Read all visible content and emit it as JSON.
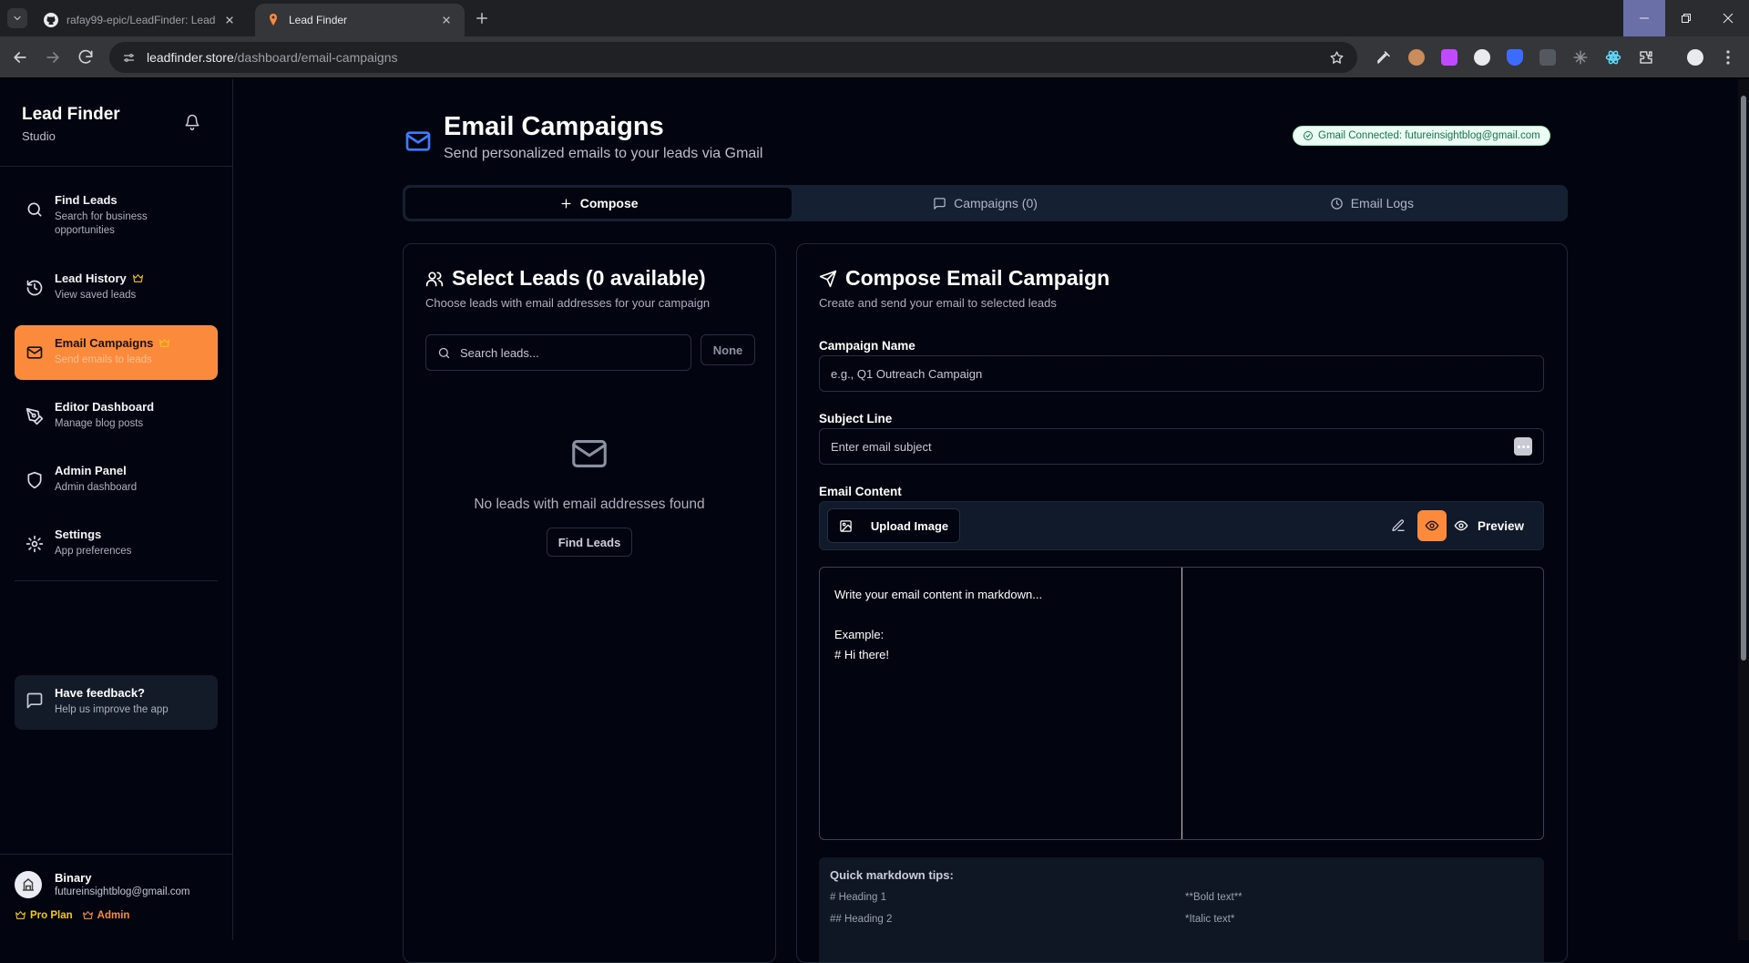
{
  "browser": {
    "tabs": [
      {
        "title": "rafay99-epic/LeadFinder: Lead",
        "icon": "github-icon"
      },
      {
        "title": "Lead Finder",
        "icon": "pin-icon"
      }
    ],
    "url_host": "leadfinder.store",
    "url_path": "/dashboard/email-campaigns"
  },
  "sidebar": {
    "brand_title": "Lead Finder",
    "brand_subtitle": "Studio",
    "items": [
      {
        "label": "Find Leads",
        "sub": "Search for business opportunities",
        "icon": "search-icon"
      },
      {
        "label": "Lead History",
        "sub": "View saved leads",
        "icon": "history-icon",
        "crown": true
      },
      {
        "label": "Email Campaigns",
        "sub": "Send emails to leads",
        "icon": "mail-icon",
        "crown": true,
        "active": true
      },
      {
        "label": "Editor Dashboard",
        "sub": "Manage blog posts",
        "icon": "pen-icon"
      },
      {
        "label": "Admin Panel",
        "sub": "Admin dashboard",
        "icon": "shield-icon"
      },
      {
        "label": "Settings",
        "sub": "App preferences",
        "icon": "gear-icon"
      }
    ],
    "feedback_title": "Have feedback?",
    "feedback_sub": "Help us improve the app",
    "user_name": "Binary",
    "user_email": "futureinsightblog@gmail.com",
    "plan": "Pro Plan",
    "role": "Admin"
  },
  "page": {
    "title": "Email Campaigns",
    "subtitle": "Send personalized emails to your leads via Gmail",
    "gmail_status": "Gmail Connected: futureinsightblog@gmail.com",
    "tabs": [
      "Compose",
      "Campaigns (0)",
      "Email Logs"
    ]
  },
  "leads": {
    "title": "Select Leads (0 available)",
    "subtitle": "Choose leads with email addresses for your campaign",
    "search_placeholder": "Search leads...",
    "none_button": "None",
    "empty_text": "No leads with email addresses found",
    "find_button": "Find Leads"
  },
  "compose": {
    "title": "Compose Email Campaign",
    "subtitle": "Create and send your email to selected leads",
    "campaign_label": "Campaign Name",
    "campaign_placeholder": "e.g., Q1 Outreach Campaign",
    "subject_label": "Subject Line",
    "subject_placeholder": "Enter email subject",
    "content_label": "Email Content",
    "upload_button": "Upload Image",
    "preview_button": "Preview",
    "editor_line1": "Write your email content in markdown...",
    "editor_line2": "Example:",
    "editor_line3": "# Hi there!",
    "tips_title": "Quick markdown tips:",
    "tips": [
      "# Heading 1",
      "**Bold text**",
      "## Heading 2",
      "*Italic text*"
    ]
  },
  "colors": {
    "accent": "#fb8a3c",
    "brand_blue": "#3b7cff",
    "crown": "#f5c518",
    "success": "#16794a"
  }
}
